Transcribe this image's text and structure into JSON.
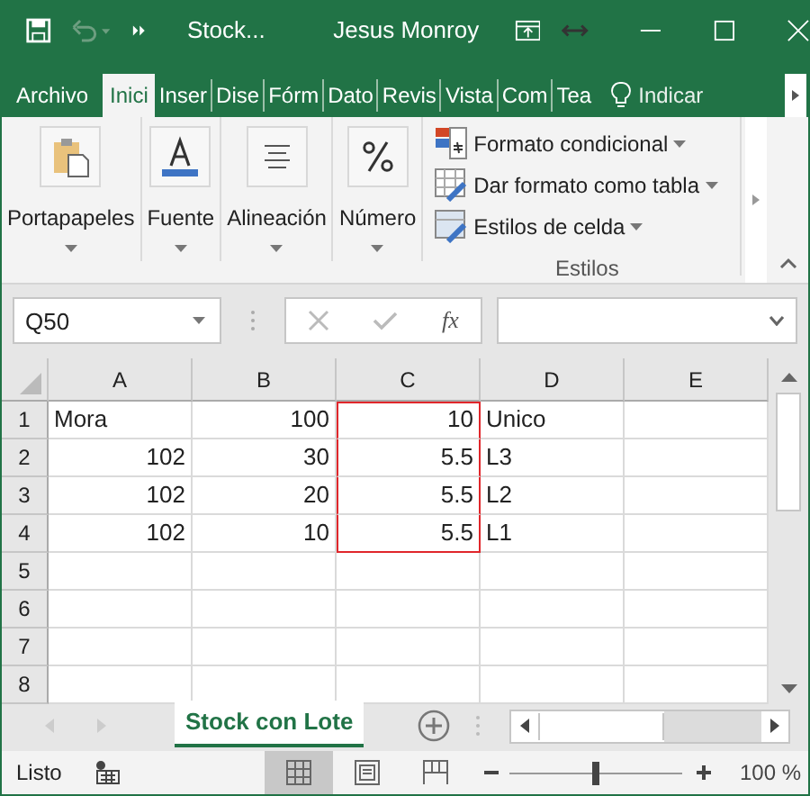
{
  "window": {
    "file_title": "Stock...",
    "user": "Jesus Monroy"
  },
  "tabs": [
    {
      "label": "Archivo",
      "selected": false
    },
    {
      "label": "Inici",
      "selected": true
    },
    {
      "label": "Inser",
      "selected": false
    },
    {
      "label": "Dise",
      "selected": false
    },
    {
      "label": "Fórm",
      "selected": false
    },
    {
      "label": "Dato",
      "selected": false
    },
    {
      "label": "Revis",
      "selected": false
    },
    {
      "label": "Vista",
      "selected": false
    },
    {
      "label": "Com",
      "selected": false
    },
    {
      "label": "Tea",
      "selected": false
    }
  ],
  "tell_me": "Indicar",
  "ribbon": {
    "groups": [
      {
        "kind": "clipboard",
        "label": "Portapapeles"
      },
      {
        "kind": "font",
        "label": "Fuente"
      },
      {
        "kind": "align",
        "label": "Alineación"
      },
      {
        "kind": "number",
        "label": "Número"
      }
    ],
    "styles": {
      "items": [
        {
          "kind": "conditional",
          "label": "Formato condicional"
        },
        {
          "kind": "table",
          "label": "Dar formato como tabla"
        },
        {
          "kind": "cellstyle",
          "label": "Estilos de celda"
        }
      ],
      "label": "Estilos"
    }
  },
  "formula_bar": {
    "name_box": "Q50",
    "function_button": "fx"
  },
  "sheet": {
    "columns": [
      "A",
      "B",
      "C",
      "D",
      "E"
    ],
    "rows": [
      {
        "header": "1",
        "cells": [
          {
            "value": "Mora",
            "kind": "text"
          },
          {
            "value": "100",
            "kind": "number"
          },
          {
            "value": "10",
            "kind": "number",
            "outlined": true
          },
          {
            "value": "Unico",
            "kind": "text"
          },
          null
        ]
      },
      {
        "header": "2",
        "cells": [
          {
            "value": "102",
            "kind": "number"
          },
          {
            "value": "30",
            "kind": "number"
          },
          {
            "value": "5.5",
            "kind": "number",
            "outlined": true
          },
          {
            "value": "L3",
            "kind": "text"
          },
          null
        ]
      },
      {
        "header": "3",
        "cells": [
          {
            "value": "102",
            "kind": "number"
          },
          {
            "value": "20",
            "kind": "number"
          },
          {
            "value": "5.5",
            "kind": "number",
            "outlined": true
          },
          {
            "value": "L2",
            "kind": "text"
          },
          null
        ]
      },
      {
        "header": "4",
        "cells": [
          {
            "value": "102",
            "kind": "number"
          },
          {
            "value": "10",
            "kind": "number"
          },
          {
            "value": "5.5",
            "kind": "number",
            "outlined": true
          },
          {
            "value": "L1",
            "kind": "text"
          },
          null
        ]
      },
      {
        "header": "5",
        "cells": [
          null,
          null,
          null,
          null,
          null
        ]
      },
      {
        "header": "6",
        "cells": [
          null,
          null,
          null,
          null,
          null
        ]
      },
      {
        "header": "7",
        "cells": [
          null,
          null,
          null,
          null,
          null
        ]
      },
      {
        "header": "8",
        "cells": [
          null,
          null,
          null,
          null,
          null
        ]
      }
    ]
  },
  "sheet_tabs": [
    {
      "label": "Stock con Lote",
      "selected": true
    }
  ],
  "status_bar": {
    "status": "Listo",
    "views": [
      {
        "kind": "normal",
        "selected": true
      },
      {
        "kind": "layout",
        "selected": false
      },
      {
        "kind": "pagebreak",
        "selected": false
      }
    ],
    "zoom": {
      "level": 0.5,
      "reading": "100 %"
    }
  }
}
